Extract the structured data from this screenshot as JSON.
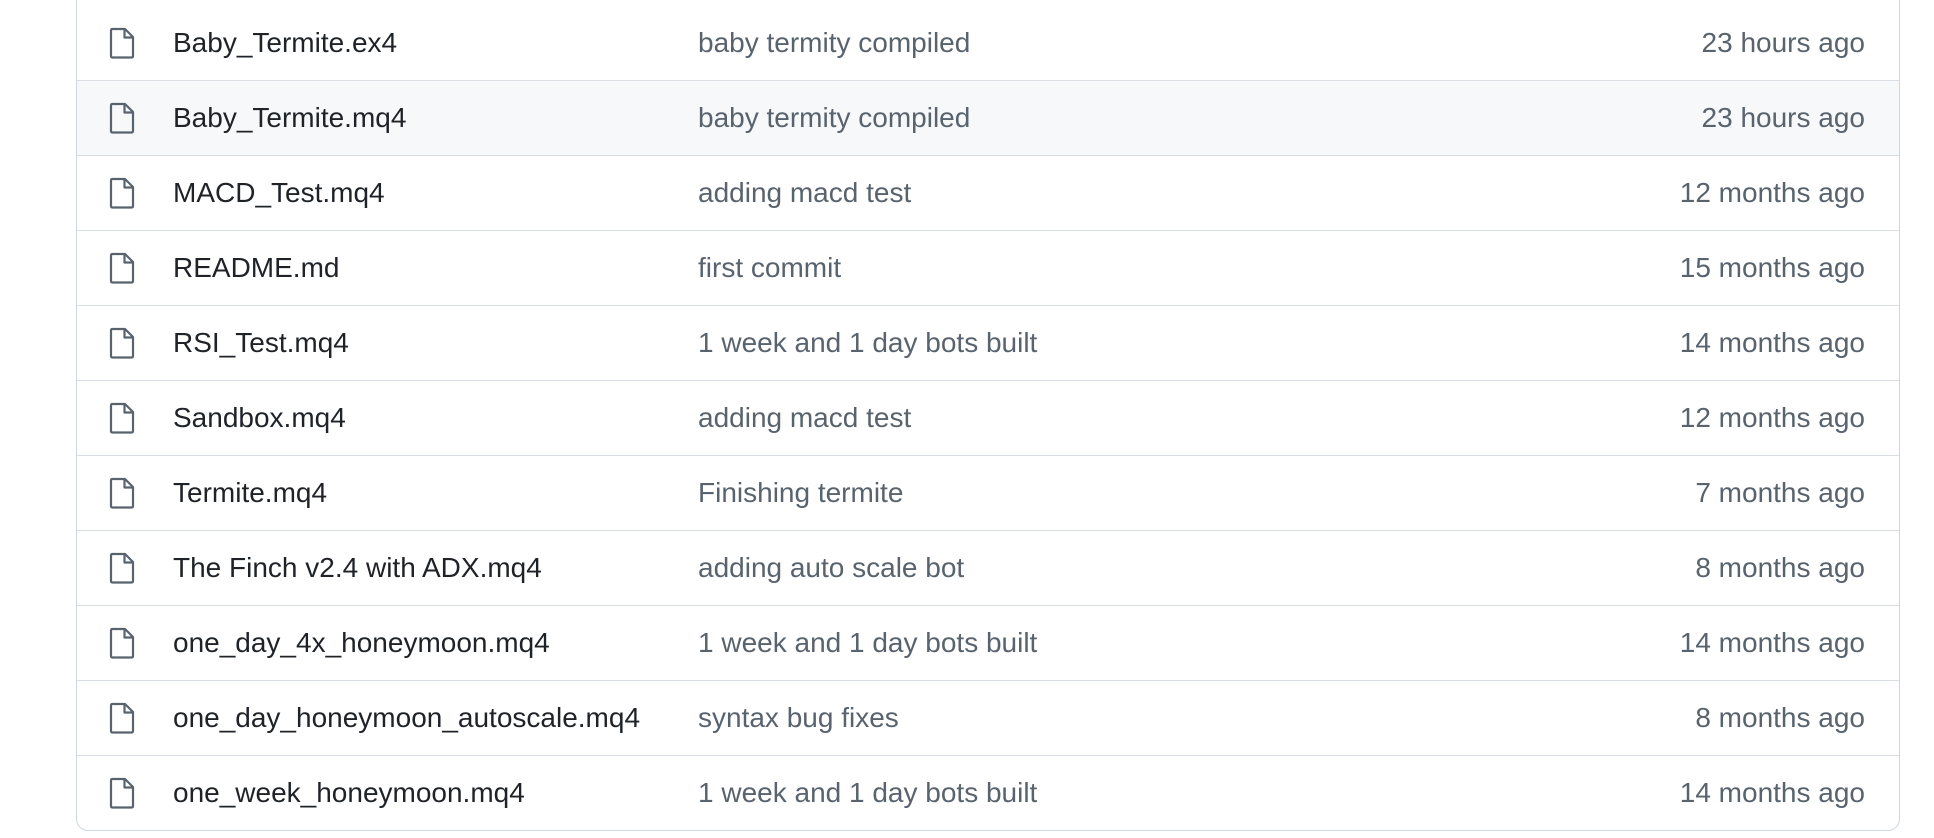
{
  "file_list": {
    "rows": [
      {
        "icon": "file-icon",
        "name": "Baby_Termite.ex4",
        "commit_message": "baby termity compiled",
        "updated": "23 hours ago"
      },
      {
        "icon": "file-icon",
        "name": "Baby_Termite.mq4",
        "commit_message": "baby termity compiled",
        "updated": "23 hours ago"
      },
      {
        "icon": "file-icon",
        "name": "MACD_Test.mq4",
        "commit_message": "adding macd test",
        "updated": "12 months ago"
      },
      {
        "icon": "file-icon",
        "name": "README.md",
        "commit_message": "first commit",
        "updated": "15 months ago"
      },
      {
        "icon": "file-icon",
        "name": "RSI_Test.mq4",
        "commit_message": "1 week and 1 day bots built",
        "updated": "14 months ago"
      },
      {
        "icon": "file-icon",
        "name": "Sandbox.mq4",
        "commit_message": "adding macd test",
        "updated": "12 months ago"
      },
      {
        "icon": "file-icon",
        "name": "Termite.mq4",
        "commit_message": "Finishing termite",
        "updated": "7 months ago"
      },
      {
        "icon": "file-icon",
        "name": "The Finch v2.4 with ADX.mq4",
        "commit_message": "adding auto scale bot",
        "updated": "8 months ago"
      },
      {
        "icon": "file-icon",
        "name": "one_day_4x_honeymoon.mq4",
        "commit_message": "1 week and 1 day bots built",
        "updated": "14 months ago"
      },
      {
        "icon": "file-icon",
        "name": "one_day_honeymoon_autoscale.mq4",
        "commit_message": "syntax bug fixes",
        "updated": "8 months ago"
      },
      {
        "icon": "file-icon",
        "name": "one_week_honeymoon.mq4",
        "commit_message": "1 week and 1 day bots built",
        "updated": "14 months ago"
      }
    ]
  },
  "colors": {
    "border": "#d0d7de",
    "row_hover_bg": "#f6f8fa",
    "name_text": "#1f2328",
    "muted_text": "#59636e"
  }
}
